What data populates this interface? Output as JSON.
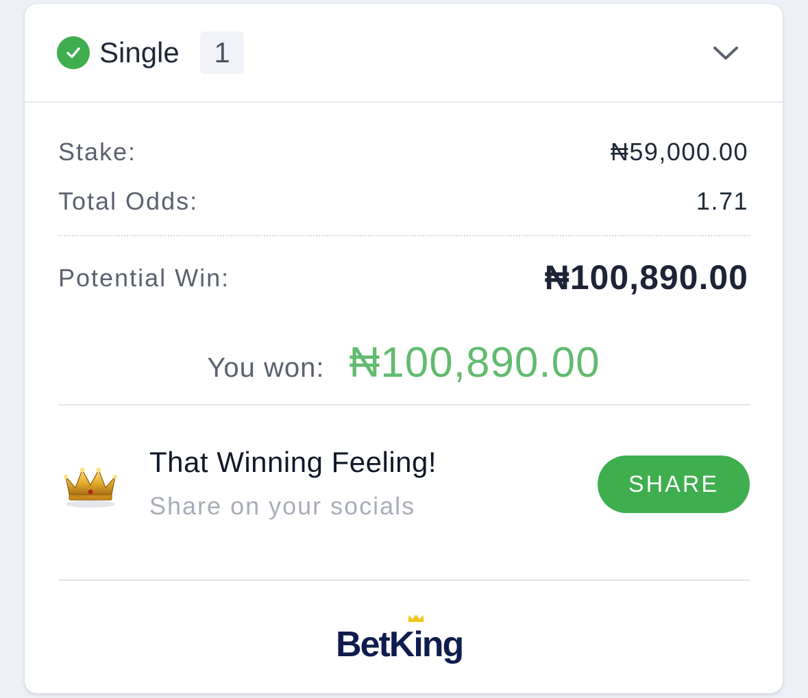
{
  "header": {
    "title": "Single",
    "count": "1",
    "status_icon": "check-circle-icon",
    "toggle_icon": "chevron-down-icon"
  },
  "summary": {
    "stake_label": "Stake:",
    "stake_value": "₦59,000.00",
    "odds_label": "Total Odds:",
    "odds_value": "1.71",
    "potential_win_label": "Potential Win:",
    "potential_win_value": "₦100,890.00"
  },
  "result": {
    "won_label": "You won:",
    "won_amount": "₦100,890.00"
  },
  "promo": {
    "icon": "crown-icon",
    "title": "That Winning Feeling!",
    "subtitle": "Share on your socials",
    "button_label": "SHARE"
  },
  "brand": {
    "name": "BetKing"
  },
  "colors": {
    "accent_green": "#3fae4f",
    "won_green": "#62bb6f",
    "brand_navy": "#0f1c4d",
    "brand_gold": "#f5c518"
  }
}
